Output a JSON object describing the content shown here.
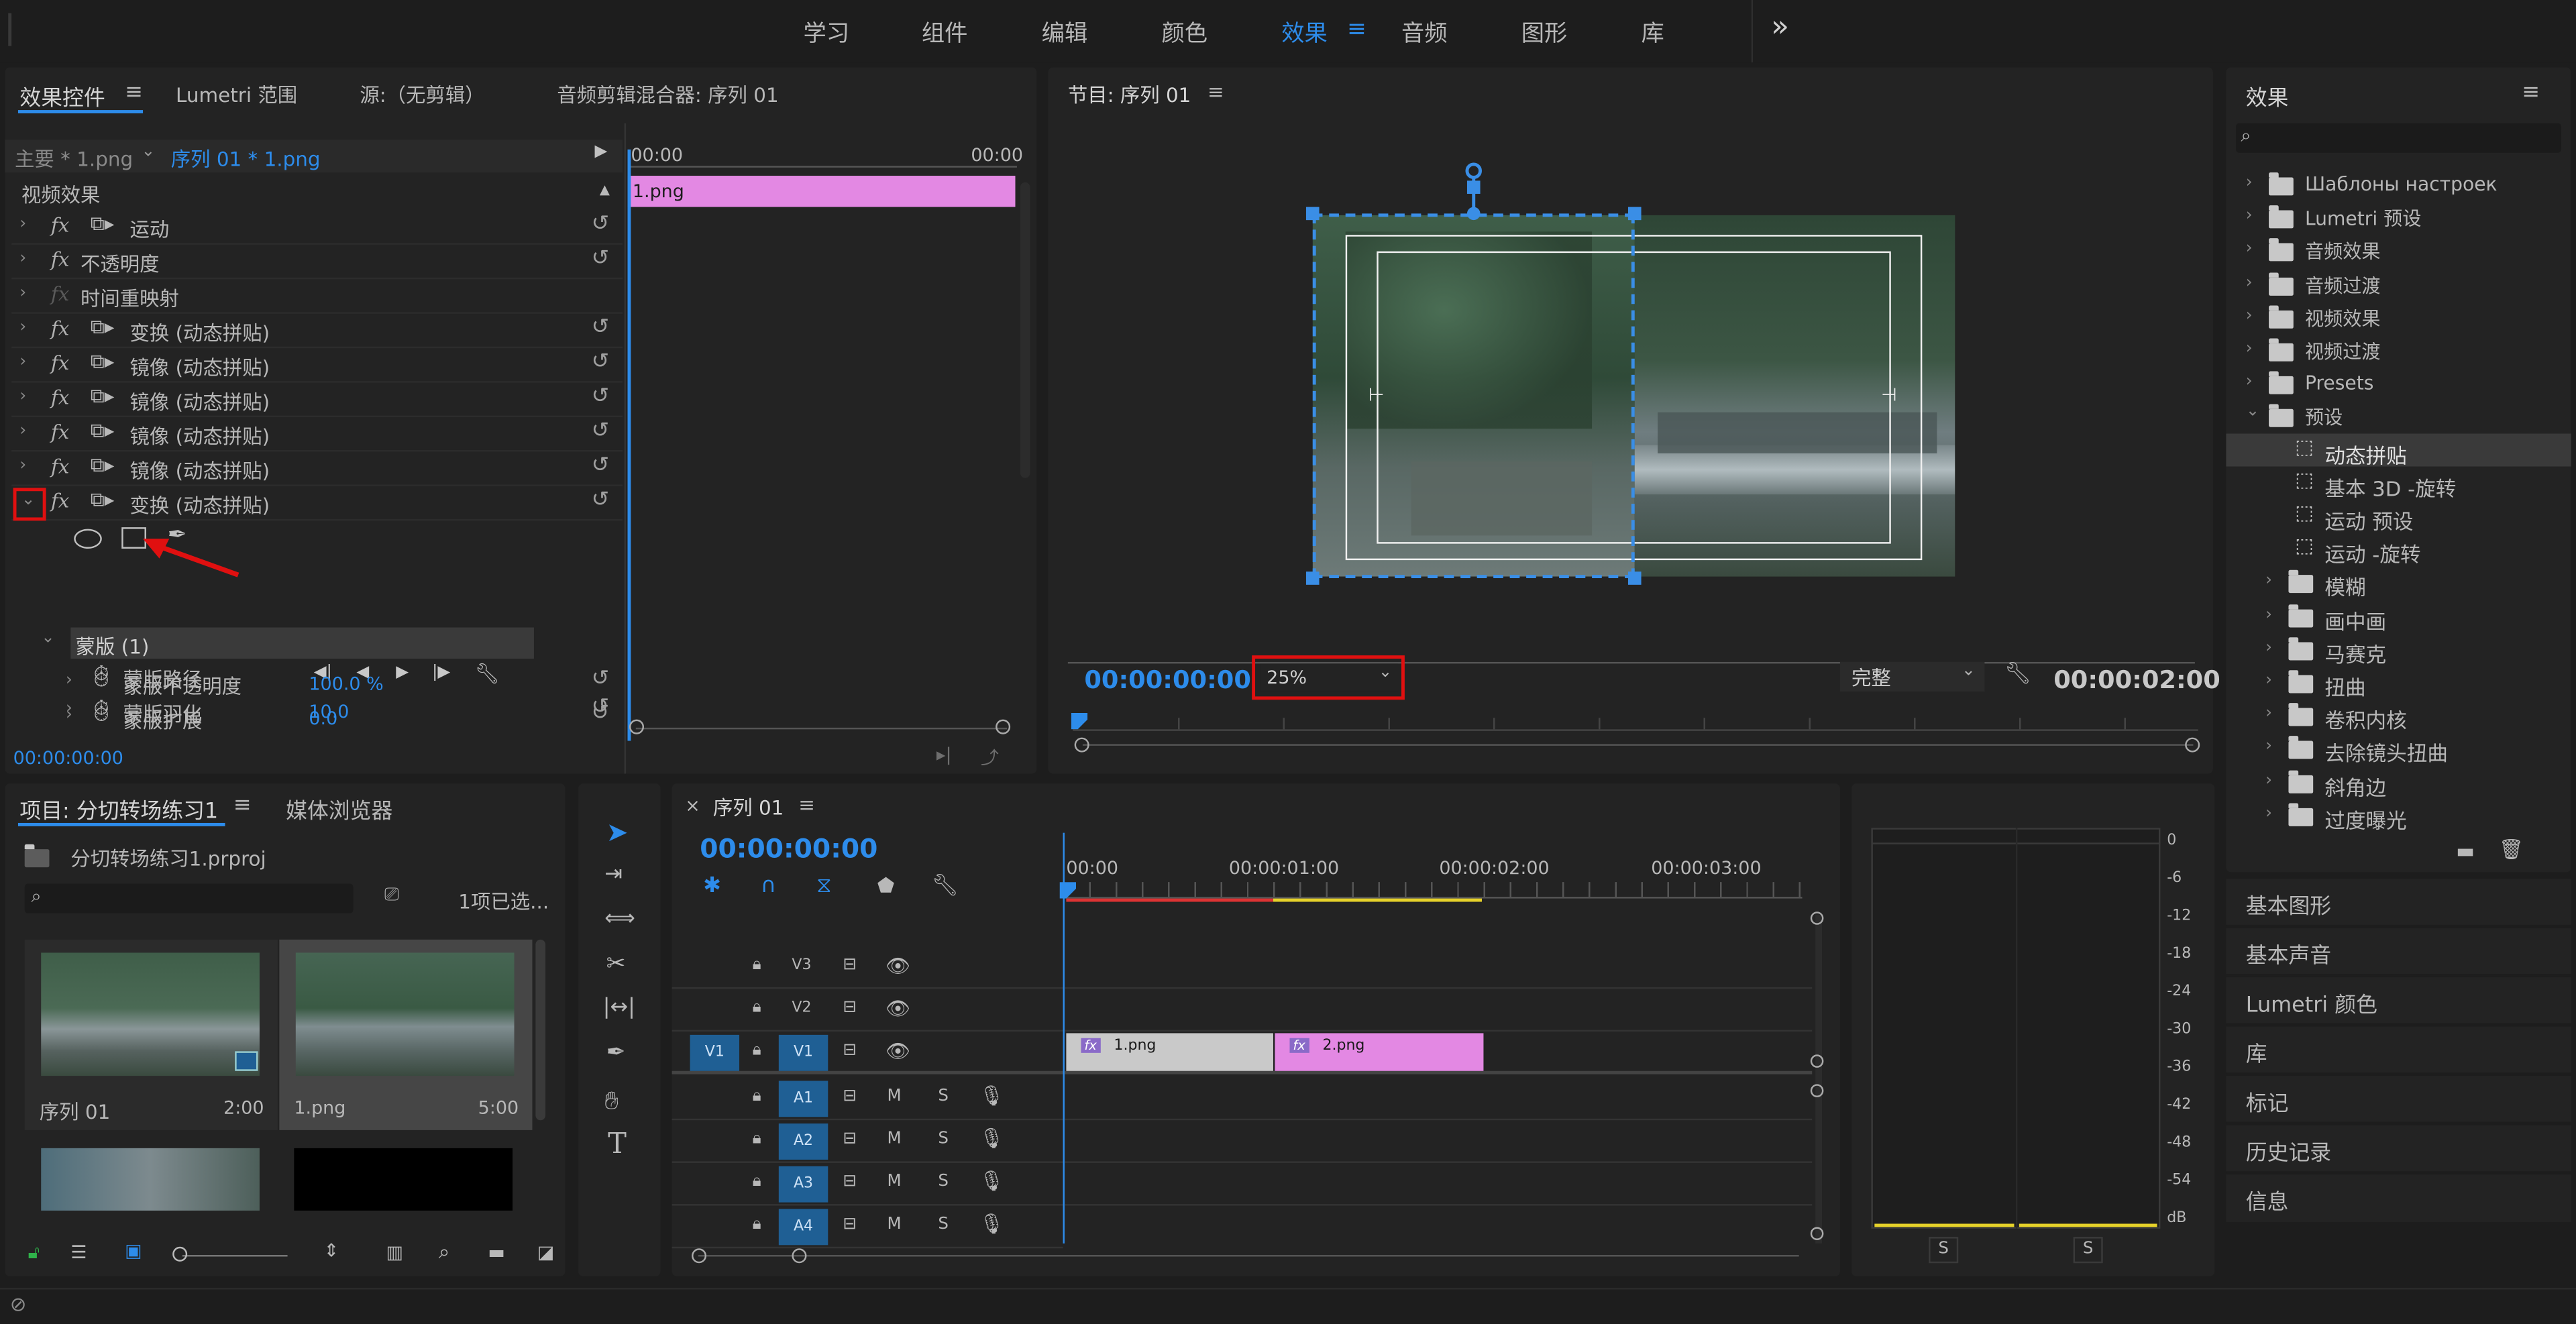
{
  "workspace": {
    "tabs": [
      "学习",
      "组件",
      "编辑",
      "颜色",
      "效果",
      "音频",
      "图形",
      "库"
    ],
    "active_tab": "效果",
    "more": "»",
    "menu": "≡"
  },
  "effect_controls": {
    "tabs": [
      "效果控件",
      "Lumetri 范围",
      "源:（无剪辑）",
      "音频剪辑混合器: 序列 01"
    ],
    "master": "主要 * 1.png",
    "sequence_clip": "序列 01 * 1.png",
    "section": "视频效果",
    "effects": [
      "运动",
      "不透明度",
      "时间重映射",
      "变换 (动态拼贴)",
      "镜像 (动态拼贴)",
      "镜像 (动态拼贴)",
      "镜像 (动态拼贴)",
      "镜像 (动态拼贴)",
      "变换 (动态拼贴)"
    ],
    "mask_label": "蒙版 (1)",
    "mask_props": [
      {
        "name": "蒙版路径",
        "value": ""
      },
      {
        "name": "蒙版羽化",
        "value": "10.0"
      },
      {
        "name": "蒙版不透明度",
        "value": "100.0 %"
      },
      {
        "name": "蒙版扩展",
        "value": "0.0"
      }
    ],
    "time_start": "00:00",
    "time_end": "00:00",
    "clip_label": "1.png",
    "timecode": "00:00:00:00"
  },
  "program": {
    "title": "节目: 序列 01",
    "timecode": "00:00:00:00",
    "zoom": "25%",
    "quality": "完整",
    "duration": "00:00:02:00"
  },
  "effects_panel": {
    "title": "效果",
    "items": [
      {
        "label": "Шаблоны настроек",
        "type": "folder-star",
        "level": 0
      },
      {
        "label": "Lumetri 预设",
        "type": "folder-star",
        "level": 0
      },
      {
        "label": "音频效果",
        "type": "folder",
        "level": 0
      },
      {
        "label": "音频过渡",
        "type": "folder",
        "level": 0
      },
      {
        "label": "视频效果",
        "type": "folder",
        "level": 0
      },
      {
        "label": "视频过渡",
        "type": "folder",
        "level": 0
      },
      {
        "label": "Presets",
        "type": "folder-star",
        "level": 0
      },
      {
        "label": "预设",
        "type": "folder-star",
        "level": 0,
        "open": true
      },
      {
        "label": "动态拼贴",
        "type": "preset",
        "level": 1,
        "selected": true
      },
      {
        "label": "基本 3D -旋转",
        "type": "preset",
        "level": 1
      },
      {
        "label": "运动 预设",
        "type": "preset",
        "level": 1
      },
      {
        "label": "运动 -旋转",
        "type": "preset",
        "level": 1
      },
      {
        "label": "模糊",
        "type": "folder-star",
        "level": 1
      },
      {
        "label": "画中画",
        "type": "folder-star",
        "level": 1
      },
      {
        "label": "马赛克",
        "type": "folder-star",
        "level": 1
      },
      {
        "label": "扭曲",
        "type": "folder-star",
        "level": 1
      },
      {
        "label": "卷积内核",
        "type": "folder-star",
        "level": 1
      },
      {
        "label": "去除镜头扭曲",
        "type": "folder-star",
        "level": 1
      },
      {
        "label": "斜角边",
        "type": "folder-star",
        "level": 1
      },
      {
        "label": "过度曝光",
        "type": "folder-star",
        "level": 1
      }
    ],
    "sections": [
      "基本图形",
      "基本声音",
      "Lumetri 颜色",
      "库",
      "标记",
      "历史记录",
      "信息"
    ]
  },
  "project": {
    "tabs": [
      "项目: 分切转场练习1",
      "媒体浏览器"
    ],
    "file": "分切转场练习1.prproj",
    "selected": "1项已选...",
    "search_placeholder": "",
    "items": [
      {
        "name": "序列 01",
        "dur": "2:00"
      },
      {
        "name": "1.png",
        "dur": "5:00"
      }
    ]
  },
  "timeline": {
    "title": "序列 01",
    "timecode": "00:00:00:00",
    "ruler": [
      "00:00",
      "00:00:01:00",
      "00:00:02:00",
      "00:00:03:00"
    ],
    "video_tracks": [
      "V3",
      "V2",
      "V1"
    ],
    "audio_tracks": [
      "A1",
      "A2",
      "A3",
      "A4"
    ],
    "src_patch": "V1",
    "m": "M",
    "s": "S",
    "clips": [
      {
        "name": "1.png",
        "fx": "fx"
      },
      {
        "name": "2.png",
        "fx": "fx"
      }
    ]
  },
  "meter": {
    "scale": [
      "0",
      "-6",
      "-12",
      "-18",
      "-24",
      "-30",
      "-36",
      "-42",
      "-48",
      "-54",
      "dB"
    ],
    "solo": [
      "S",
      "S"
    ]
  },
  "colors": {
    "accent": "#2d8ceb",
    "clip_pink": "#e388e3",
    "clip_grey": "#c9c9c9",
    "highlight": "#e01010"
  }
}
